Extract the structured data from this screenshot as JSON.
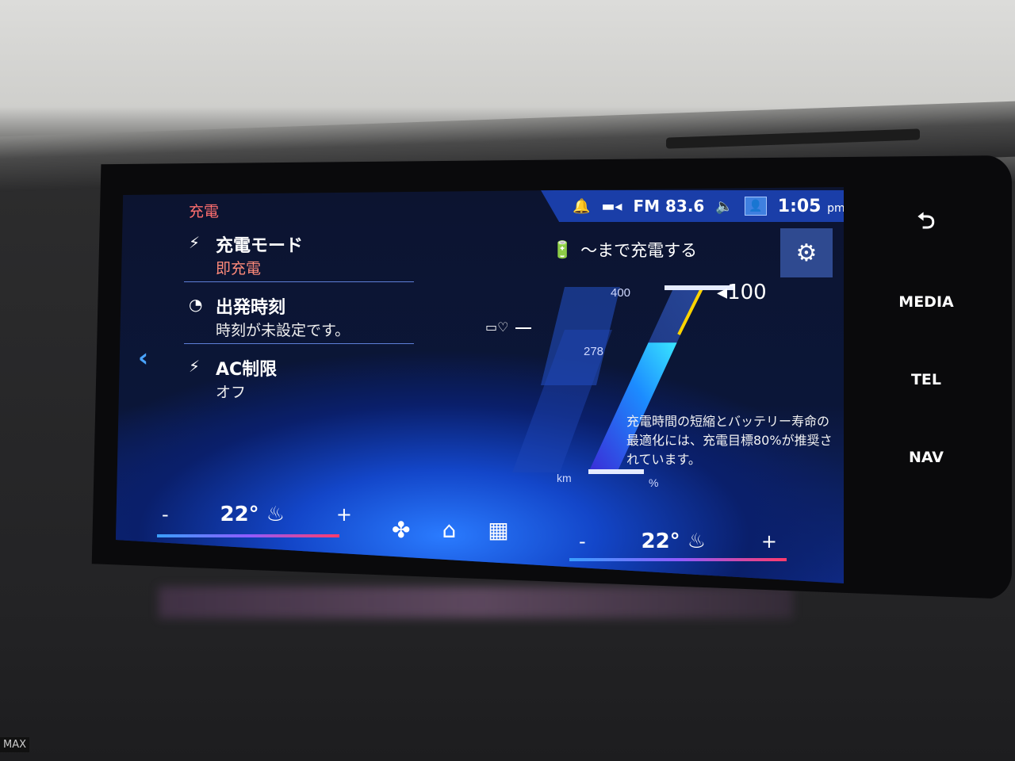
{
  "status_bar": {
    "bell_icon": "bell-icon",
    "signal_icon": "signal-icon",
    "radio": "FM 83.6",
    "speaker_icon": "speaker-icon",
    "time": "1:05",
    "ampm": "pm"
  },
  "page": {
    "title": "充電"
  },
  "menu": [
    {
      "title": "充電モード",
      "value": "即充電",
      "icon": "plug-icon"
    },
    {
      "title": "出発時刻",
      "value": "時刻が未設定です。",
      "icon": "clock-icon"
    },
    {
      "title": "AC制限",
      "value": "オフ",
      "icon": "ac-plug-icon"
    }
  ],
  "charge_panel": {
    "target_label": "～まで充電する",
    "target_value": "100",
    "km_unit": "km",
    "pct_unit": "%",
    "top_km": "400",
    "current_km": "278",
    "hint": "充電時間の短縮とバッテリー寿命の最適化には、充電目標80%が推奨されています。",
    "charge_fraction": 0.7,
    "target_fraction": 1.0
  },
  "climate": {
    "left_minus": "-",
    "left_temp": "22°",
    "left_plus": "+",
    "right_minus": "-",
    "right_temp": "22°",
    "right_plus": "+"
  },
  "side_buttons": {
    "back": "⮌",
    "media": "MEDIA",
    "tel": "TEL",
    "nav": "NAV"
  },
  "hardware": {
    "max_label": "MAX"
  },
  "colors": {
    "accent_red": "#ff6e6e",
    "status_bar": "#1a3ea8",
    "bar_blue": "#3aa0ff",
    "bar_pink": "#ff3b6b",
    "target_yellow": "#ffd400"
  }
}
